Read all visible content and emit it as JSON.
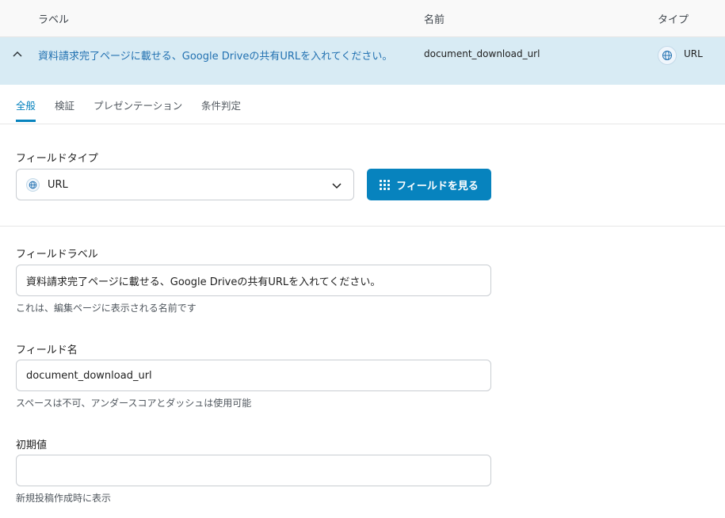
{
  "table_header": {
    "label_col": "ラベル",
    "name_col": "名前",
    "type_col": "タイプ"
  },
  "field_row": {
    "label": "資料請求完了ページに載せる、Google Driveの共有URLを入れてください。",
    "name": "document_download_url",
    "type": "URL",
    "type_icon": "globe-icon",
    "expand_icon": "chevron-up-icon"
  },
  "tabs": [
    {
      "label": "全般",
      "active": true
    },
    {
      "label": "検証",
      "active": false
    },
    {
      "label": "プレゼンテーション",
      "active": false
    },
    {
      "label": "条件判定",
      "active": false
    }
  ],
  "field_type": {
    "label": "フィールドタイプ",
    "value": "URL",
    "icon": "globe-icon",
    "browse_button": "フィールドを見る"
  },
  "field_label": {
    "label": "フィールドラベル",
    "value": "資料請求完了ページに載せる、Google Driveの共有URLを入れてください。",
    "help": "これは、編集ページに表示される名前です"
  },
  "field_name": {
    "label": "フィールド名",
    "value": "document_download_url",
    "help": "スペースは不可、アンダースコアとダッシュは使用可能"
  },
  "default_value": {
    "label": "初期値",
    "value": "",
    "help": "新規投稿作成時に表示"
  },
  "colors": {
    "accent": "#0783be",
    "row_highlight": "#d8ebf4",
    "link": "#2271b1"
  }
}
